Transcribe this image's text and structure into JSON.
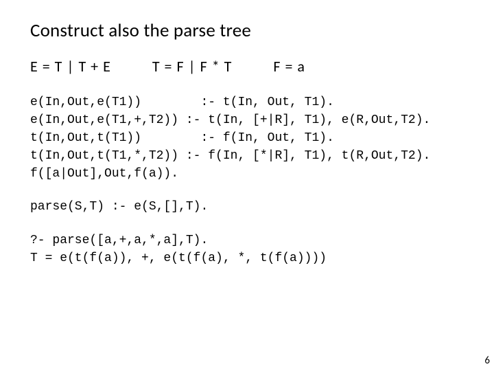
{
  "title": "Construct also the parse tree",
  "grammar": {
    "e": "E = T | T + E",
    "t": "T = F | F * T",
    "f": "F = a"
  },
  "clauses": {
    "l1": "e(In,Out,e(T1))        :- t(In, Out, T1).",
    "l2": "e(In,Out,e(T1,+,T2)) :- t(In, [+|R], T1), e(R,Out,T2).",
    "l3": "t(In,Out,t(T1))        :- f(In, Out, T1).",
    "l4": "t(In,Out,t(T1,*,T2)) :- f(In, [*|R], T1), t(R,Out,T2).",
    "l5": "f([a|Out],Out,f(a))."
  },
  "parse_rule": "parse(S,T) :- e(S,[],T).",
  "query": {
    "q": "?- parse([a,+,a,*,a],T).",
    "r": "T = e(t(f(a)), +, e(t(f(a), *, t(f(a))))"
  },
  "page_number": "6"
}
